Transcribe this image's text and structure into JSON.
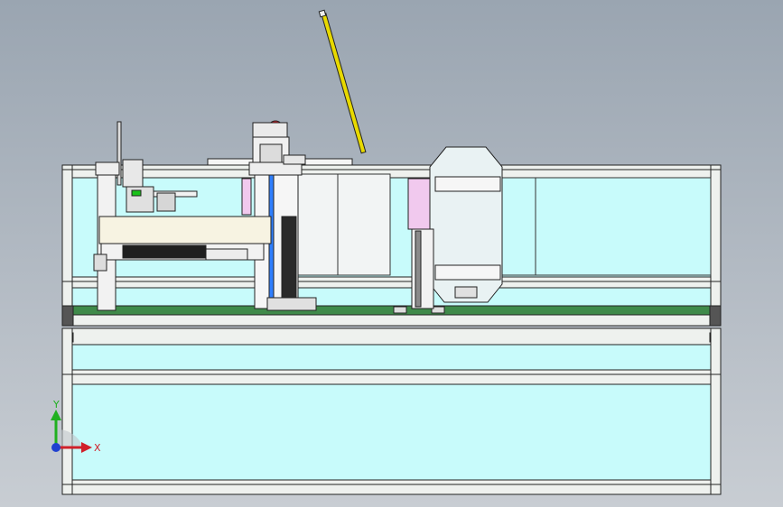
{
  "view": {
    "background_top": "#9aa5b1",
    "background_bottom": "#c8cdd3",
    "glass_color": "#c8fbfb",
    "frame_color": "#eef1ee",
    "rail_color": "#3f8a4a",
    "accent_yellow": "#e8d900",
    "accent_red": "#e0202a",
    "accent_pink": "#f1c9ee",
    "accent_blue": "#2f7fff",
    "accent_green": "#19c219"
  },
  "triad": {
    "x_label": "X",
    "y_label": "Y",
    "x_color": "#d0202a",
    "y_color": "#20b020",
    "z_color": "#2040d0"
  }
}
